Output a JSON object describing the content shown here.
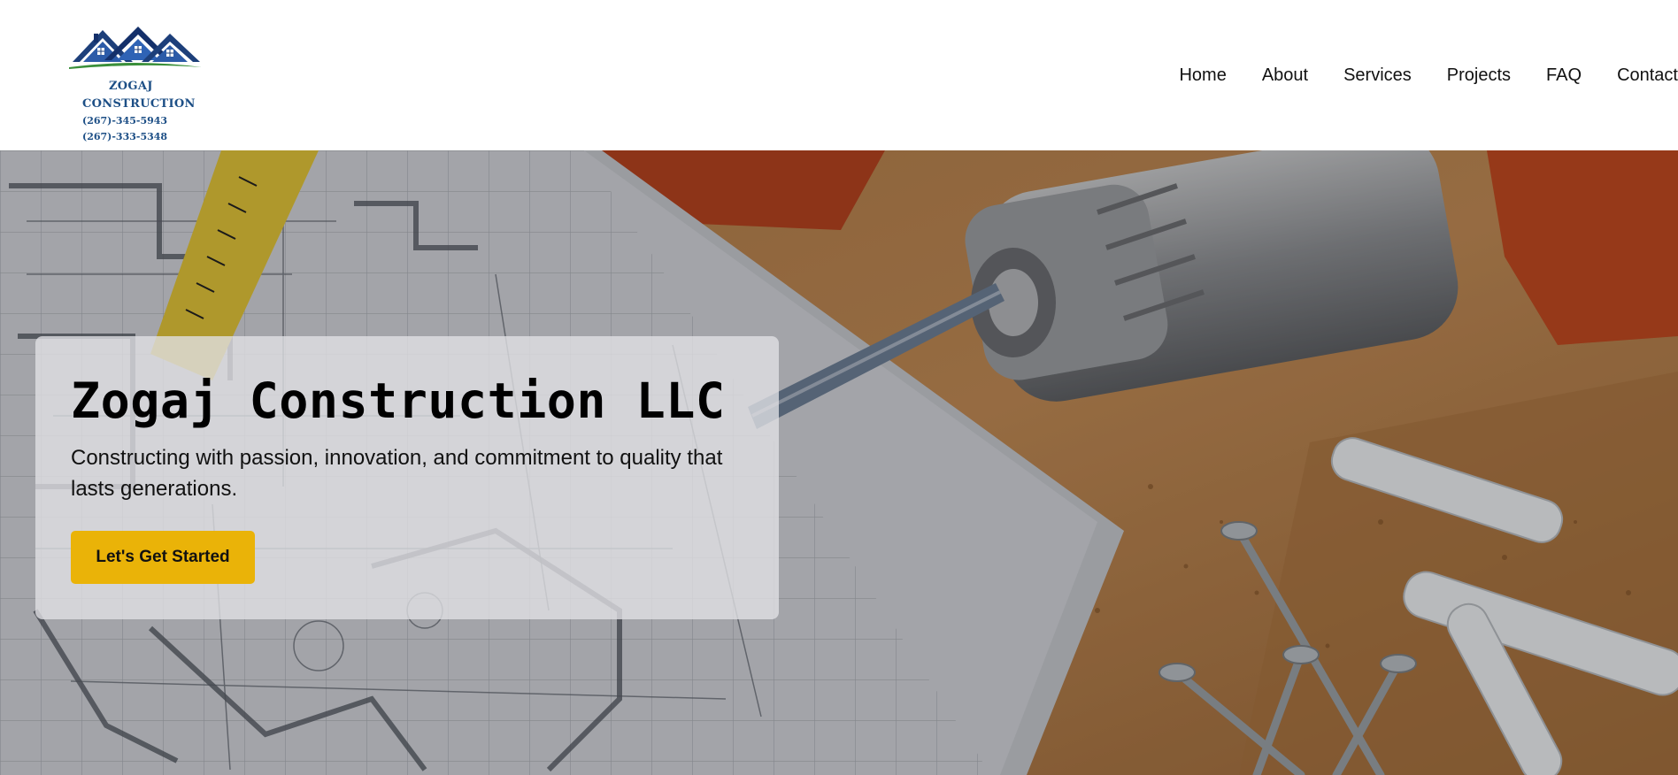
{
  "brand": {
    "name_line1": "ZOGAJ",
    "name_line2": "CONSTRUCTION",
    "phone1": "(267)-345-5943",
    "phone2": "(267)-333-5348",
    "logo_icon": "house-roofs-logo-icon"
  },
  "nav": {
    "items": [
      {
        "label": "Home"
      },
      {
        "label": "About"
      },
      {
        "label": "Services"
      },
      {
        "label": "Projects"
      },
      {
        "label": "FAQ"
      },
      {
        "label": "Contact"
      }
    ]
  },
  "hero": {
    "title": "Zogaj Construction LLC",
    "subtitle": "Constructing with passion, innovation, and commitment to quality that lasts generations.",
    "cta_label": "Let's Get Started",
    "background_icon": "blueprint-drill-screws-photo"
  },
  "colors": {
    "accent": "#eab308",
    "brand_blue": "#1d4f86",
    "brand_green": "#3a8f3a"
  }
}
